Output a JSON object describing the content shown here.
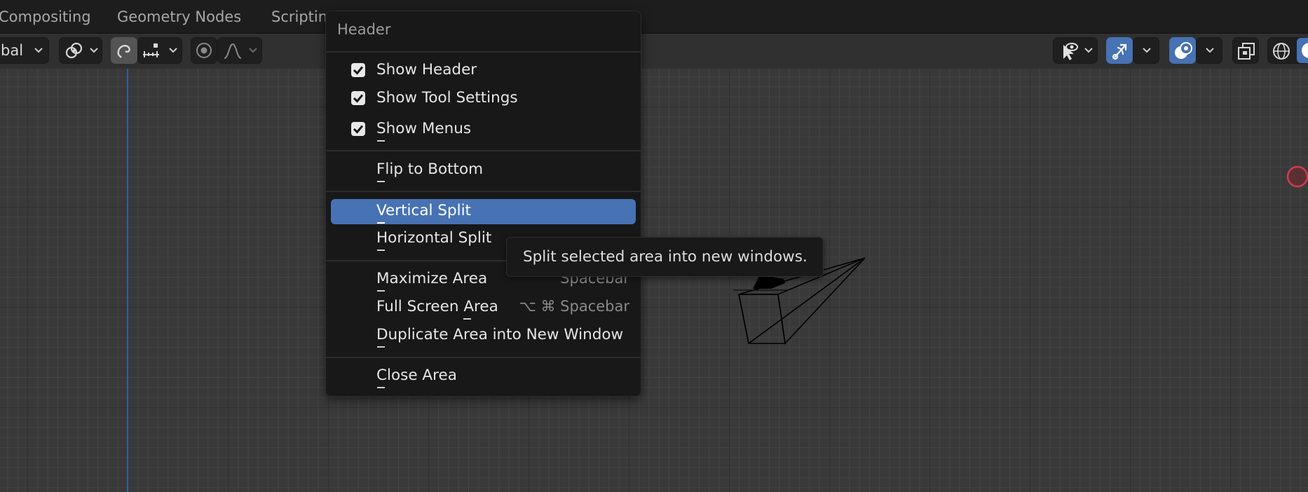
{
  "workspace_tabs": [
    "Compositing",
    "Geometry Nodes",
    "Scripting"
  ],
  "header": {
    "transform_orientation": "bal",
    "toggle_icons": [
      "transform-orientation-chevron-icon",
      "pivot-point-icon",
      "snap-icon",
      "snap-increment-icon",
      "proportional-editing-icon",
      "proportional-falloff-icon",
      "visibility-selectability-icon",
      "gizmo-icon",
      "overlays-icon",
      "xray-icon",
      "wireframe-shading-icon",
      "solid-shading-icon"
    ]
  },
  "menu": {
    "title": "Header",
    "items": [
      {
        "label": "Show Header",
        "checked": true
      },
      {
        "label": "Show Tool Settings",
        "checked": true
      },
      {
        "label": "Show Menus",
        "checked": true
      },
      {
        "label": "Flip to Bottom"
      },
      {
        "label": "Vertical Split",
        "highlighted": true
      },
      {
        "label": "Horizontal Split"
      },
      {
        "label": "Maximize Area",
        "shortcut": "^ Spacebar"
      },
      {
        "label": "Full Screen Area",
        "shortcut": "⌥ ⌘ Spacebar"
      },
      {
        "label": "Duplicate Area into New Window"
      },
      {
        "label": "Close Area"
      }
    ]
  },
  "tooltip": {
    "text": "Split selected area into new windows."
  },
  "colors": {
    "highlight": "#4772b3",
    "menu_bg": "#181818",
    "viewport_bg": "#393939",
    "axis_blue": "#2d5fa3",
    "light_red": "#d03c4b"
  }
}
